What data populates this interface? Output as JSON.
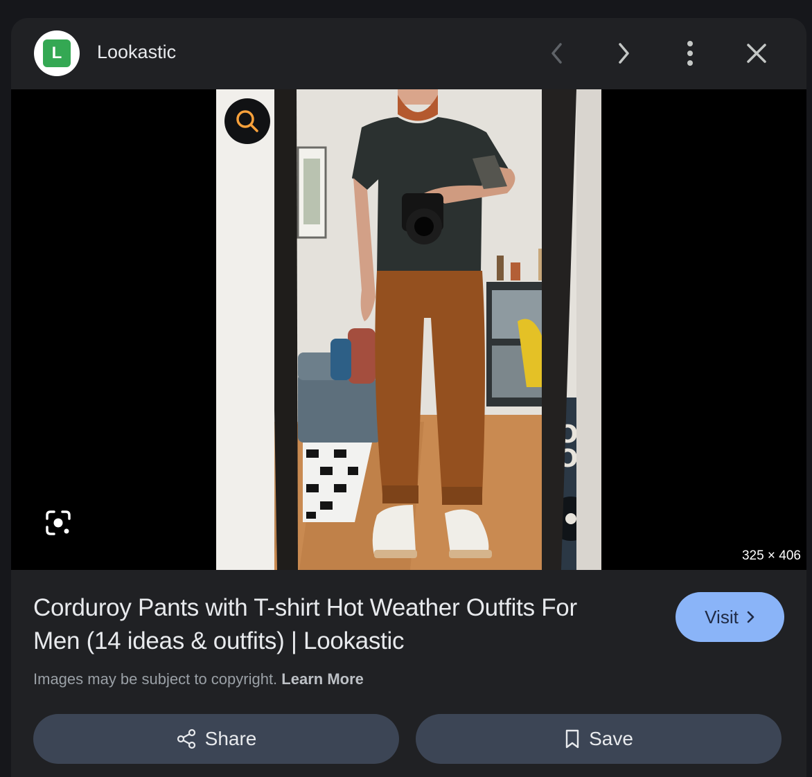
{
  "header": {
    "favicon_letter": "L",
    "site_name": "Lookastic"
  },
  "image": {
    "dimensions": "325 × 406"
  },
  "result": {
    "title": "Corduroy Pants with T-shirt Hot Weather Outfits For Men (14 ideas & outfits) | Lookastic",
    "copyright_text": "Images may be subject to copyright.",
    "learn_more": "Learn More",
    "visit_label": "Visit"
  },
  "actions": {
    "share_label": "Share",
    "save_label": "Save"
  },
  "colors": {
    "favicon_bg": "#34a853",
    "visit_bg": "#8ab4f8",
    "action_bg": "#3c4555",
    "lens_accent": "#f9a13b"
  }
}
